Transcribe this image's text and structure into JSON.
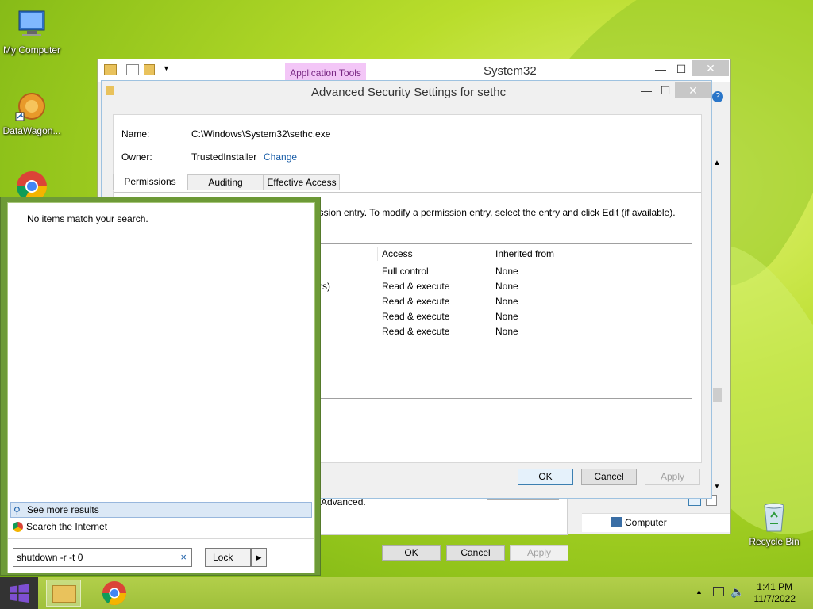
{
  "desktop": {
    "icons": [
      {
        "label": "My Computer",
        "icon": "computer-icon"
      },
      {
        "label": "DataWagon...",
        "icon": "datawagon-icon"
      },
      {
        "label": "Recycle Bin",
        "icon": "recycle-bin-icon"
      }
    ]
  },
  "explorer": {
    "title": "System32",
    "context_tab": "Application Tools",
    "lower_dialog": {
      "advanced_text": "Advanced.",
      "ok_label": "OK",
      "cancel_label": "Cancel",
      "apply_label": "Apply"
    },
    "status_item": "Computer"
  },
  "advanced_security": {
    "title": "Advanced Security Settings for sethc",
    "name_label": "Name:",
    "name_value": "C:\\Windows\\System32\\sethc.exe",
    "owner_label": "Owner:",
    "owner_value": "TrustedInstaller",
    "change_link": "Change",
    "tabs": [
      "Permissions",
      "Auditing",
      "Effective Access"
    ],
    "instruction": "ission entry. To modify a permission entry, select the entry and click Edit (if available).",
    "columns": {
      "access": "Access",
      "inherited": "Inherited from"
    },
    "partial_principal": "tors)",
    "rows": [
      {
        "access": "Full control",
        "inherited": "None"
      },
      {
        "access": "Read & execute",
        "inherited": "None"
      },
      {
        "access": "Read & execute",
        "inherited": "None"
      },
      {
        "access": "Read & execute",
        "inherited": "None"
      },
      {
        "access": "Read & execute",
        "inherited": "None"
      }
    ],
    "buttons": {
      "ok": "OK",
      "cancel": "Cancel",
      "apply": "Apply"
    }
  },
  "search": {
    "no_results": "No items match your search.",
    "see_more": "See more results",
    "search_internet": "Search the Internet",
    "query": "shutdown -r -t 0",
    "clear_symbol": "×",
    "power_label": "Lock"
  },
  "taskbar": {
    "time": "1:41 PM",
    "date": "11/7/2022"
  },
  "colors": {
    "accent_green": "#6d9a37",
    "app_tools_pink": "#f3c6f7",
    "link_blue": "#1a5ea8"
  }
}
